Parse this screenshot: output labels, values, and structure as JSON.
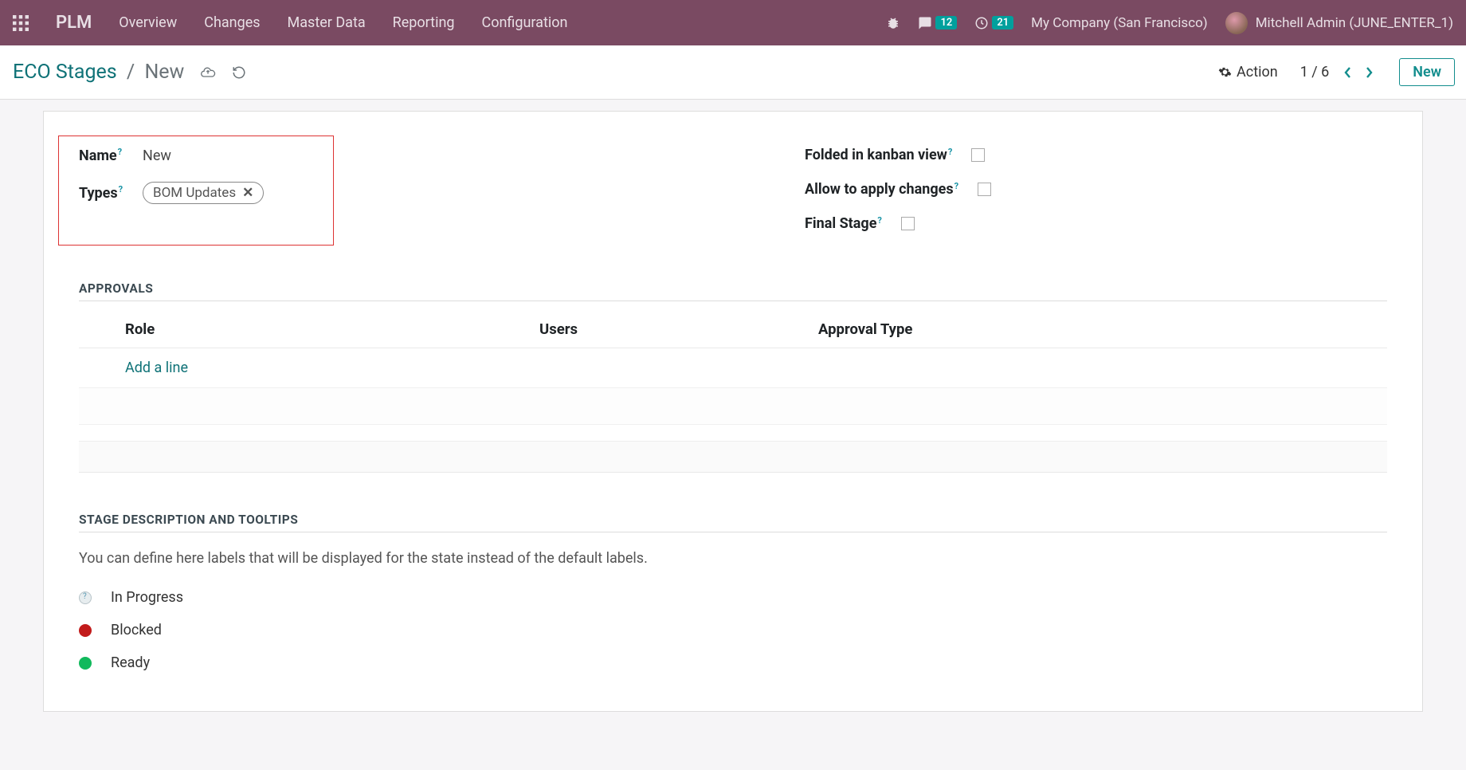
{
  "topbar": {
    "brand": "PLM",
    "nav": [
      "Overview",
      "Changes",
      "Master Data",
      "Reporting",
      "Configuration"
    ],
    "msg_count": "12",
    "activity_count": "21",
    "company": "My Company (San Francisco)",
    "user": "Mitchell Admin (JUNE_ENTER_1)"
  },
  "controlbar": {
    "bc_root": "ECO Stages",
    "bc_current": "New",
    "action_label": "Action",
    "pager": "1 / 6",
    "new_label": "New"
  },
  "form": {
    "name_label": "Name",
    "name_value": "New",
    "types_label": "Types",
    "tag_value": "BOM Updates",
    "folded_label": "Folded in kanban view",
    "allow_label": "Allow to apply changes",
    "final_label": "Final Stage"
  },
  "approvals": {
    "section": "APPROVALS",
    "col_role": "Role",
    "col_users": "Users",
    "col_type": "Approval Type",
    "add_line": "Add a line"
  },
  "stagedesc": {
    "section": "STAGE DESCRIPTION AND TOOLTIPS",
    "help_text": "You can define here labels that will be displayed for the state instead of the default labels.",
    "in_progress": "In Progress",
    "blocked": "Blocked",
    "ready": "Ready"
  }
}
